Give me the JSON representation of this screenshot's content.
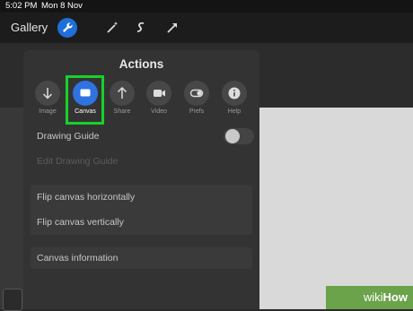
{
  "status": {
    "time": "5:02 PM",
    "date": "Mon 8 Nov"
  },
  "toolbar": {
    "gallery_label": "Gallery",
    "icons": [
      "wrench-icon",
      "magic-wand-icon",
      "smudge-s-icon",
      "arrow-cursor-icon"
    ],
    "active_color": "#1e6fd9"
  },
  "panel": {
    "title": "Actions",
    "actions": [
      {
        "label": "Image",
        "icon": "download-arrow-icon"
      },
      {
        "label": "Canvas",
        "icon": "canvas-icon",
        "selected": true
      },
      {
        "label": "Share",
        "icon": "share-arrow-icon"
      },
      {
        "label": "Video",
        "icon": "video-camera-icon"
      },
      {
        "label": "Prefs",
        "icon": "toggle-icon"
      },
      {
        "label": "Help",
        "icon": "info-icon"
      }
    ],
    "rows": {
      "drawing_guide": "Drawing Guide",
      "edit_drawing_guide": "Edit Drawing Guide",
      "flip_h": "Flip canvas horizontally",
      "flip_v": "Flip canvas vertically",
      "canvas_info": "Canvas information"
    },
    "drawing_guide_on": false
  },
  "highlight_color": "#18d12b",
  "watermark": {
    "wiki": "wiki",
    "how": "How"
  }
}
